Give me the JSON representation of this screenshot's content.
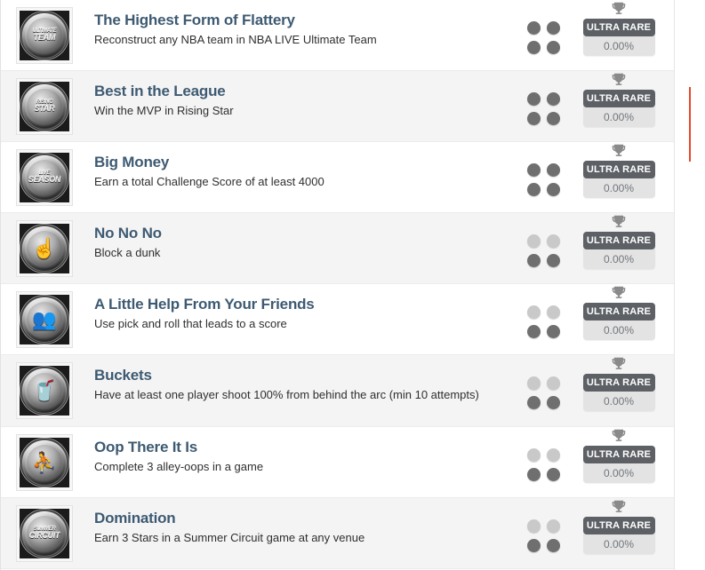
{
  "list": {
    "rows": [
      {
        "title": "The Highest Form of Flattery",
        "desc": "Reconstruct any NBA team in NBA LIVE Ultimate Team",
        "icon_name": "ultimate-team-medal-icon",
        "medal_line1": "ULTIMATE",
        "medal_line2": "TEAM",
        "difficulty_filled": 4,
        "rarity_label": "ULTRA RARE",
        "rarity_pct": "0.00%",
        "trophy_icon": "trophy-icon"
      },
      {
        "title": "Best in the League",
        "desc": "Win the MVP in Rising Star",
        "icon_name": "rising-star-medal-icon",
        "medal_line1": "RISING",
        "medal_line2": "STAR",
        "difficulty_filled": 4,
        "rarity_label": "ULTRA RARE",
        "rarity_pct": "0.00%",
        "trophy_icon": "trophy-icon"
      },
      {
        "title": "Big Money",
        "desc": "Earn a total Challenge Score of at least 4000",
        "icon_name": "live-season-medal-icon",
        "medal_line1": "LIVE",
        "medal_line2": "SEASON",
        "difficulty_filled": 4,
        "rarity_label": "ULTRA RARE",
        "rarity_pct": "0.00%",
        "trophy_icon": "trophy-icon"
      },
      {
        "title": "No No No",
        "desc": "Block a dunk",
        "icon_name": "blocking-hand-medal-icon",
        "medal_glyph": "☝",
        "difficulty_filled": 2,
        "rarity_label": "ULTRA RARE",
        "rarity_pct": "0.00%",
        "trophy_icon": "trophy-icon"
      },
      {
        "title": "A Little Help From Your Friends",
        "desc": "Use pick and roll that leads to a score",
        "icon_name": "teammates-medal-icon",
        "medal_glyph": "👥",
        "difficulty_filled": 2,
        "rarity_label": "ULTRA RARE",
        "rarity_pct": "0.00%",
        "trophy_icon": "trophy-icon"
      },
      {
        "title": "Buckets",
        "desc": "Have at least one player shoot 100% from behind the arc (min 10 attempts)",
        "icon_name": "buckets-medal-icon",
        "medal_glyph": "🥤",
        "difficulty_filled": 2,
        "rarity_label": "ULTRA RARE",
        "rarity_pct": "0.00%",
        "trophy_icon": "trophy-icon"
      },
      {
        "title": "Oop There It Is",
        "desc": "Complete 3 alley-oops in a game",
        "icon_name": "dunk-medal-icon",
        "medal_glyph": "⛹",
        "difficulty_filled": 2,
        "rarity_label": "ULTRA RARE",
        "rarity_pct": "0.00%",
        "trophy_icon": "trophy-icon"
      },
      {
        "title": "Domination",
        "desc": "Earn 3 Stars in a Summer Circuit game at any venue",
        "icon_name": "summer-circuit-medal-icon",
        "medal_line1": "SUMMER",
        "medal_line2": "CIRCUIT",
        "difficulty_filled": 2,
        "rarity_label": "ULTRA RARE",
        "rarity_pct": "0.00%",
        "trophy_icon": "trophy-icon"
      }
    ]
  },
  "colors": {
    "title": "#3d5a72",
    "rarity_pill": "#5d6166",
    "rarity_box": "#e3e3e3",
    "dot_on": "#6f6f6f",
    "dot_off": "#c9c9c9",
    "accent_rule": "#e8472b"
  }
}
